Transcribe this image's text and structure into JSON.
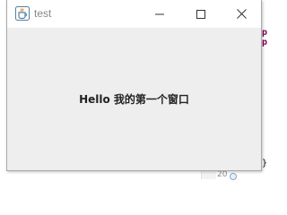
{
  "background_ide": {
    "code_lines": [
      "p",
      "p"
    ],
    "closing_brace": "}",
    "line_number": "20"
  },
  "window": {
    "title": "test",
    "icon": "java-coffee-cup-icon",
    "controls": {
      "minimize": "minimize-icon",
      "maximize": "maximize-icon",
      "close": "close-icon"
    },
    "content": {
      "label": "Hello 我的第一个窗口"
    }
  },
  "colors": {
    "titlebar": "#ffffff",
    "client": "#eeeeee",
    "title_text": "#888888",
    "java_blue": "#5382a1",
    "java_orange": "#e76f00",
    "keyword": "#7f0055"
  }
}
